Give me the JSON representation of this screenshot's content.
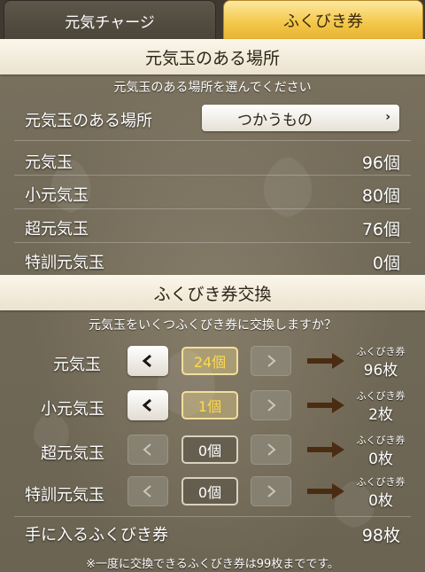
{
  "tabs": {
    "charge": "元気チャージ",
    "ticket": "ふくびき券"
  },
  "location_section": {
    "title": "元気玉のある場所",
    "instruction": "元気玉のある場所を選んでください",
    "location_label": "元気玉のある場所",
    "location_value": "つかうもの",
    "items": [
      {
        "label": "元気玉",
        "count": "96個"
      },
      {
        "label": "小元気玉",
        "count": "80個"
      },
      {
        "label": "超元気玉",
        "count": "76個"
      },
      {
        "label": "特訓元気玉",
        "count": "0個"
      }
    ]
  },
  "exchange_section": {
    "title": "ふくびき券交換",
    "question": "元気玉をいくつふくびき券に交換しますか？",
    "ticket_caption": "ふくびき券",
    "rows": [
      {
        "label": "元気玉",
        "quantity": "24個",
        "tickets": "96枚",
        "minus_enabled": true,
        "plus_enabled": false,
        "highlight": true
      },
      {
        "label": "小元気玉",
        "quantity": "1個",
        "tickets": "2枚",
        "minus_enabled": true,
        "plus_enabled": false,
        "highlight": true
      },
      {
        "label": "超元気玉",
        "quantity": "0個",
        "tickets": "0枚",
        "minus_enabled": false,
        "plus_enabled": false,
        "highlight": false
      },
      {
        "label": "特訓元気玉",
        "quantity": "0個",
        "tickets": "0枚",
        "minus_enabled": false,
        "plus_enabled": false,
        "highlight": false
      }
    ],
    "total_label": "手に入るふくびき券",
    "total_value": "98枚",
    "footer_note": "※一度に交換できるふくびき券は99枚までです。"
  },
  "icons": {
    "left": "chevron-left-icon",
    "right": "chevron-right-icon",
    "select": "chevron-right-icon",
    "trade": "arrow-right-icon"
  },
  "colors": {
    "tab_active": "#f4c84b",
    "highlight_qty": "#ffd94a",
    "trade_arrow": "#4a2c12"
  }
}
